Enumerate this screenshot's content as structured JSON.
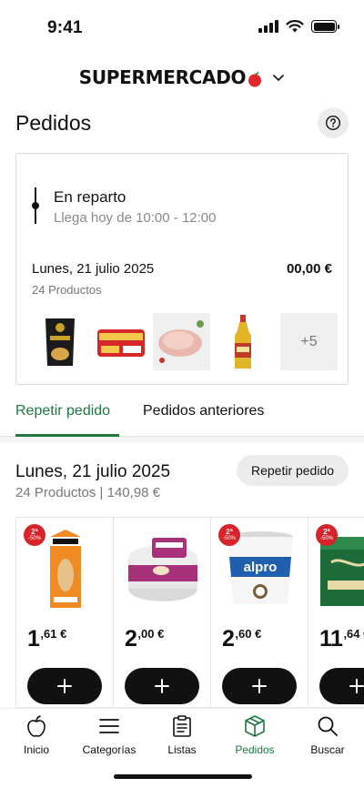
{
  "status_bar": {
    "time": "9:41"
  },
  "brand": {
    "name": "SUPERMERCADO"
  },
  "page": {
    "title": "Pedidos"
  },
  "order_card": {
    "status_title": "En reparto",
    "status_subtitle": "Llega hoy de 10:00 - 12:00",
    "date": "Lunes, 21 julio 2025",
    "total": "00,00 €",
    "count": "24 Productos",
    "more_label": "+5",
    "thumbnails": [
      "chips-bag",
      "canned-tuna-pack",
      "pork-loin-tray",
      "olive-oil-bottle"
    ]
  },
  "tabs": [
    {
      "label": "Repetir pedido",
      "active": true
    },
    {
      "label": "Pedidos anteriores",
      "active": false
    }
  ],
  "repeat": {
    "date": "Lunes, 21 julio 2025",
    "meta": "24 Productos  | 140,98 €",
    "button_label": "Repetir pedido"
  },
  "products": [
    {
      "image": "oat-drink-carton",
      "badge_top": "2ª",
      "badge_bottom": "-50%",
      "price_int": "1",
      "price_dec": ",61 €"
    },
    {
      "image": "hummus-tub",
      "badge_top": "",
      "badge_bottom": "",
      "price_int": "2",
      "price_dec": ",00 €"
    },
    {
      "image": "coconut-yogurt-pot",
      "badge_top": "2ª",
      "badge_bottom": "-50%",
      "price_int": "2",
      "price_dec": ",60 €"
    },
    {
      "image": "green-box-product",
      "badge_top": "2ª",
      "badge_bottom": "-50%",
      "price_int": "11",
      "price_dec": ",64 €"
    }
  ],
  "nav": [
    {
      "label": "Inicio",
      "icon": "apple-icon",
      "active": false
    },
    {
      "label": "Categorías",
      "icon": "menu-icon",
      "active": false
    },
    {
      "label": "Listas",
      "icon": "clipboard-icon",
      "active": false
    },
    {
      "label": "Pedidos",
      "icon": "box-icon",
      "active": true
    },
    {
      "label": "Buscar",
      "icon": "search-icon",
      "active": false
    }
  ],
  "colors": {
    "accent": "#1d7a3c",
    "promo": "#d6242a",
    "brand_apple": "#e3262b"
  }
}
